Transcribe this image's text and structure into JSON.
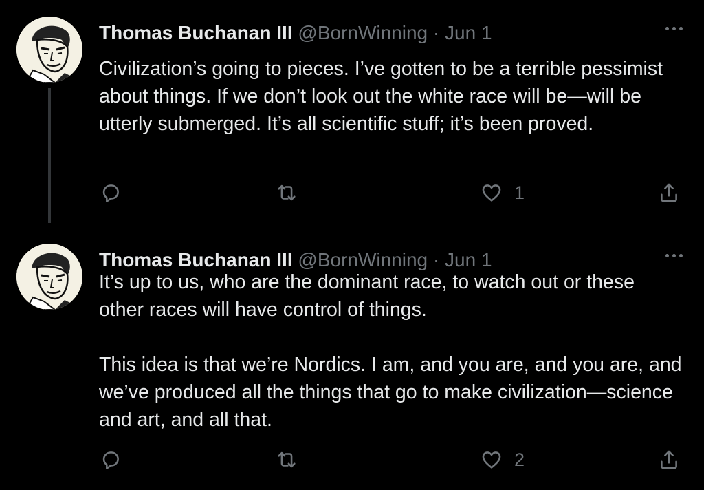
{
  "tweets": [
    {
      "author": {
        "name": "Thomas Buchanan III",
        "handle": "@BornWinning"
      },
      "separator": "·",
      "date": "Jun 1",
      "paragraphs": [
        "Civilization’s going to pieces. I’ve gotten to be a terrible pessimist about things. If we don’t look out the white race will be—will be utterly submerged. It’s all scientific stuff; it’s been proved."
      ],
      "likes": "1",
      "icons": [
        "reply-icon",
        "retweet-icon",
        "heart-icon",
        "share-icon",
        "more-icon"
      ]
    },
    {
      "author": {
        "name": "Thomas Buchanan III",
        "handle": "@BornWinning"
      },
      "separator": "·",
      "date": "Jun 1",
      "paragraphs": [
        "It’s up to us, who are the dominant race, to watch out or these other races will have control of things.",
        "This idea is that we’re Nordics. I am, and you are, and you are, and we’ve produced all the things that go to make civilization—science and art, and all that."
      ],
      "likes": "2",
      "icons": [
        "reply-icon",
        "retweet-icon",
        "heart-icon",
        "share-icon",
        "more-icon"
      ]
    }
  ],
  "colors": {
    "background": "#000000",
    "text_primary": "#e7e9ea",
    "text_secondary": "#71767b",
    "thread_line": "#333639"
  }
}
